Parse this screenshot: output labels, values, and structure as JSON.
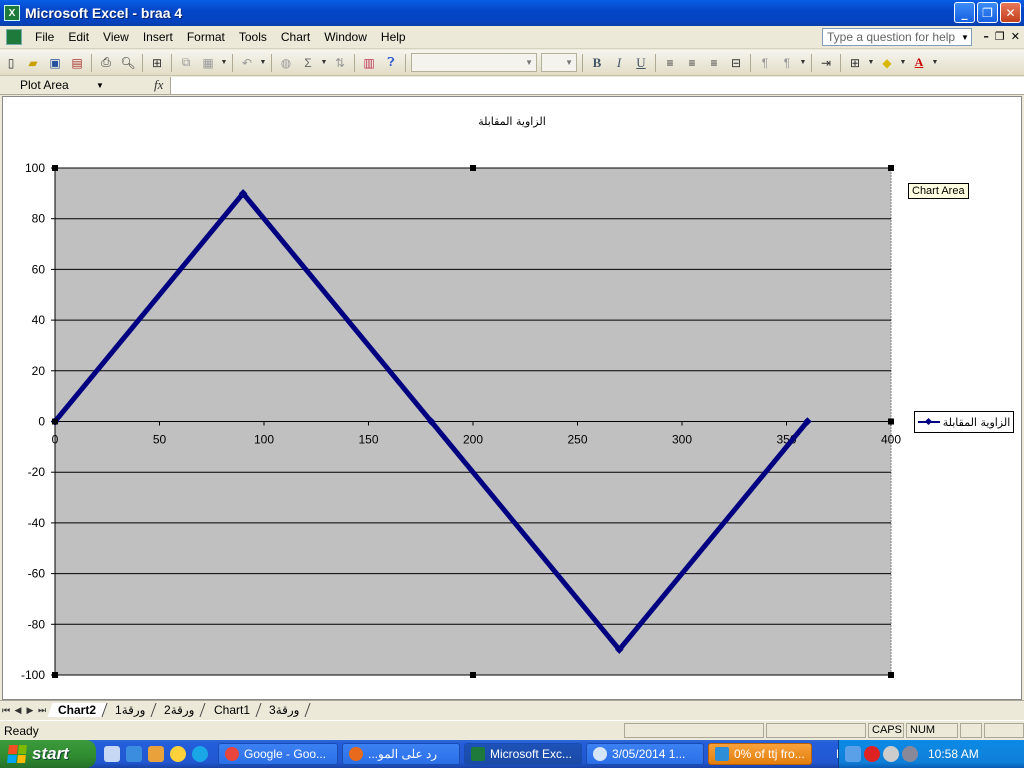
{
  "window": {
    "title": "Microsoft Excel - braa 4"
  },
  "menu": {
    "items": [
      "File",
      "Edit",
      "View",
      "Insert",
      "Format",
      "Tools",
      "Chart",
      "Window",
      "Help"
    ],
    "help_placeholder": "Type a question for help"
  },
  "formula_bar": {
    "name_box": "Plot Area",
    "fx_label": "fx"
  },
  "chart": {
    "tooltip": "Chart Area",
    "legend_label": "الزاوية المقابلة"
  },
  "chart_data": {
    "type": "line",
    "title": "الزاوية المقابلة",
    "xlabel": "",
    "ylabel": "",
    "x": [
      0,
      90,
      180,
      270,
      360
    ],
    "series": [
      {
        "name": "الزاوية المقابلة",
        "x": [
          0,
          90,
          180,
          270,
          360
        ],
        "values": [
          0,
          90,
          0,
          -90,
          0
        ],
        "color": "#000080"
      }
    ],
    "xlim": [
      0,
      400
    ],
    "ylim": [
      -100,
      100
    ],
    "xticks": [
      "0",
      "50",
      "100",
      "150",
      "200",
      "250",
      "300",
      "350",
      "400"
    ],
    "yticks": [
      "100",
      "80",
      "60",
      "40",
      "20",
      "0",
      "-20",
      "-40",
      "-60",
      "-80",
      "-100"
    ],
    "plot_background": "#c0c0c0",
    "grid": true,
    "legend_position": "right"
  },
  "sheets": {
    "tabs": [
      "Chart2",
      "ورقة1",
      "ورقة2",
      "Chart1",
      "ورقة3"
    ],
    "active": "Chart2"
  },
  "status": {
    "left": "Ready",
    "caps": "CAPS",
    "num": "NUM"
  },
  "taskbar": {
    "start_label": "start",
    "buttons": [
      "Google - Goo...",
      "...رد على المو",
      "Microsoft Exc...",
      "3/05/2014  1...",
      "0% of ttj fro..."
    ],
    "lang": "EN",
    "clock": "10:58 AM"
  }
}
